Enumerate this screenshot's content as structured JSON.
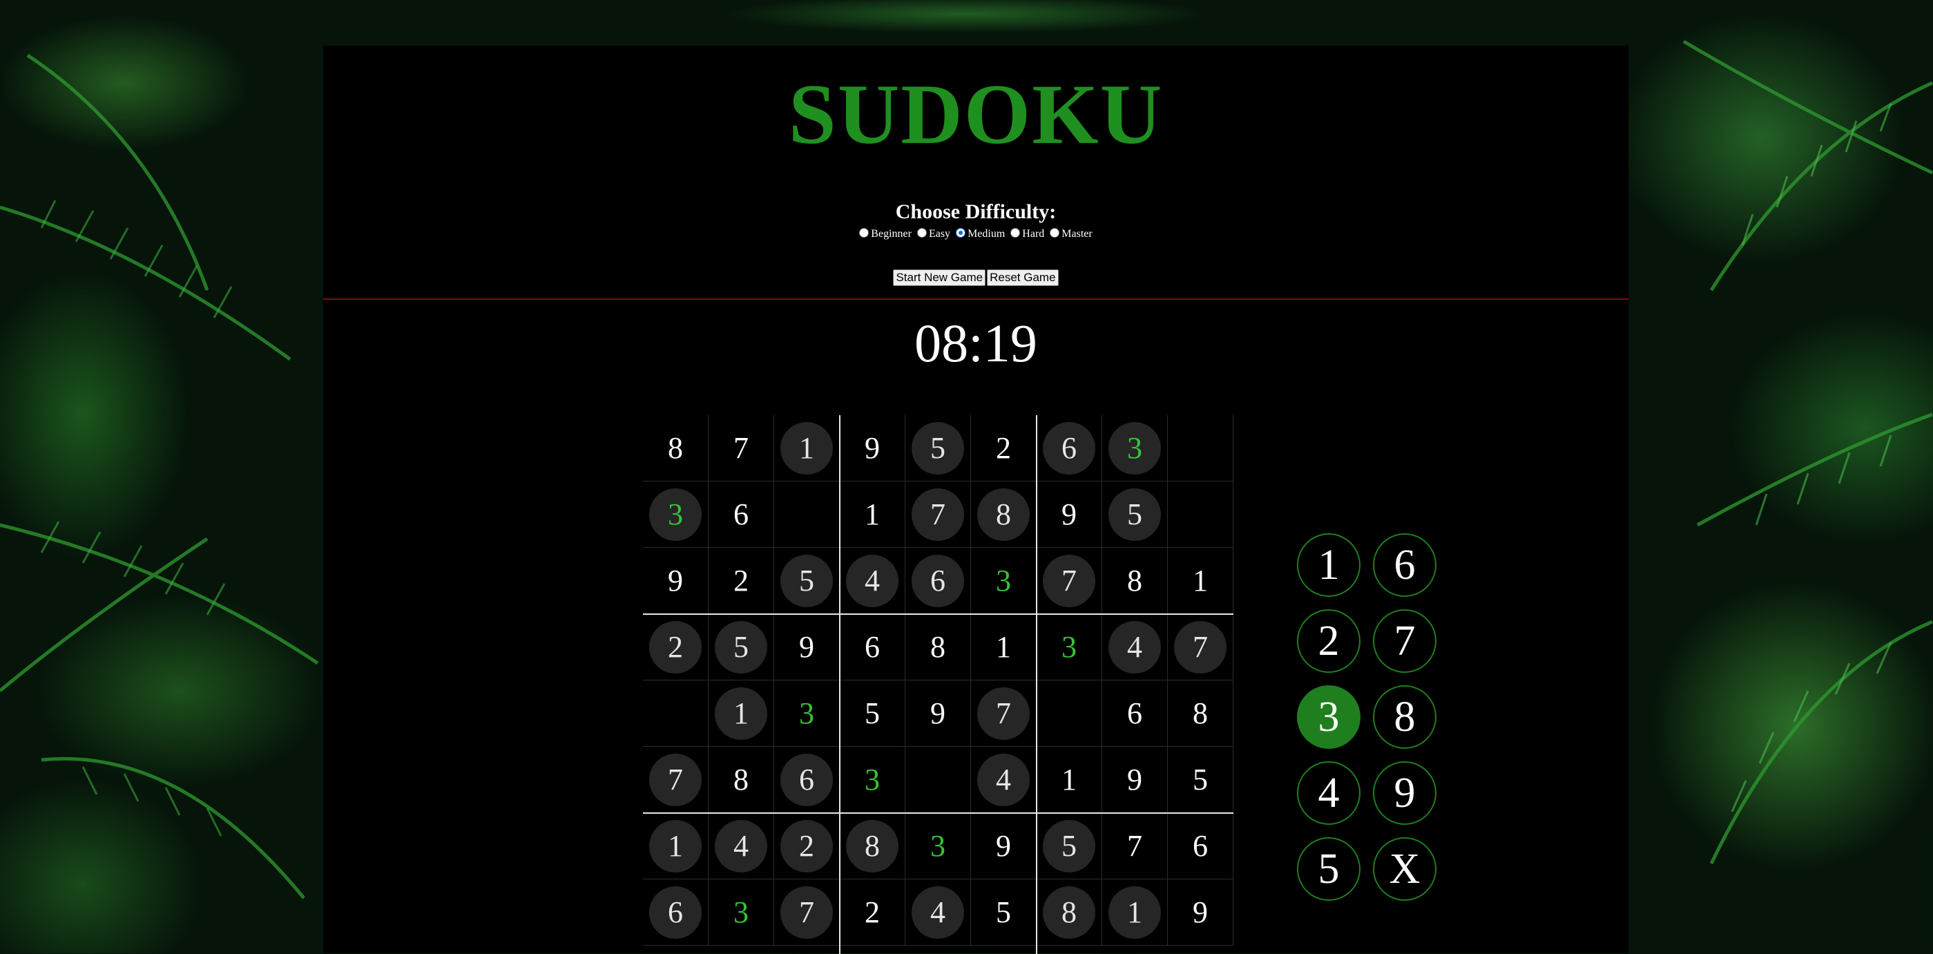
{
  "title": "SUDOKU",
  "difficulty": {
    "label": "Choose Difficulty:",
    "options": [
      "Beginner",
      "Easy",
      "Medium",
      "Hard",
      "Master"
    ],
    "selected": "Medium"
  },
  "buttons": {
    "new_game": "Start New Game",
    "reset": "Reset Game"
  },
  "timer": "08:19",
  "board": {
    "rows": [
      [
        "8",
        "7",
        "1",
        "9",
        "5",
        "2",
        "6",
        "3",
        ""
      ],
      [
        "3",
        "6",
        "",
        "1",
        "7",
        "8",
        "9",
        "5",
        ""
      ],
      [
        "9",
        "2",
        "5",
        "4",
        "6",
        "3",
        "7",
        "8",
        "1"
      ],
      [
        "2",
        "5",
        "9",
        "6",
        "8",
        "1",
        "3",
        "4",
        "7"
      ],
      [
        "",
        "1",
        "3",
        "5",
        "9",
        "7",
        "",
        "6",
        "8"
      ],
      [
        "7",
        "8",
        "6",
        "3",
        "",
        "4",
        "1",
        "9",
        "5"
      ],
      [
        "1",
        "4",
        "2",
        "8",
        "3",
        "9",
        "5",
        "7",
        "6"
      ],
      [
        "6",
        "3",
        "7",
        "2",
        "4",
        "5",
        "8",
        "1",
        "9"
      ]
    ],
    "given": [
      [
        false,
        false,
        true,
        false,
        true,
        false,
        true,
        true,
        false
      ],
      [
        true,
        false,
        false,
        false,
        true,
        true,
        false,
        true,
        false
      ],
      [
        false,
        false,
        true,
        true,
        true,
        false,
        true,
        false,
        false
      ],
      [
        true,
        true,
        false,
        false,
        false,
        false,
        false,
        true,
        true
      ],
      [
        false,
        true,
        false,
        false,
        false,
        true,
        false,
        false,
        false
      ],
      [
        true,
        false,
        true,
        false,
        false,
        true,
        false,
        false,
        false
      ],
      [
        true,
        true,
        true,
        true,
        false,
        false,
        true,
        false,
        false
      ],
      [
        true,
        false,
        true,
        false,
        true,
        false,
        true,
        true,
        false
      ]
    ],
    "highlighted_number": "3",
    "highlight_color": "#35c435"
  },
  "number_pad": {
    "left_column": [
      "1",
      "2",
      "3",
      "4",
      "5"
    ],
    "right_column": [
      "6",
      "7",
      "8",
      "9",
      "X"
    ],
    "selected": "3",
    "accent_color": "#1f7f1f"
  },
  "colors": {
    "title": "#1f8f1f",
    "divider": "#7a0f0f",
    "panel": "#000000"
  }
}
